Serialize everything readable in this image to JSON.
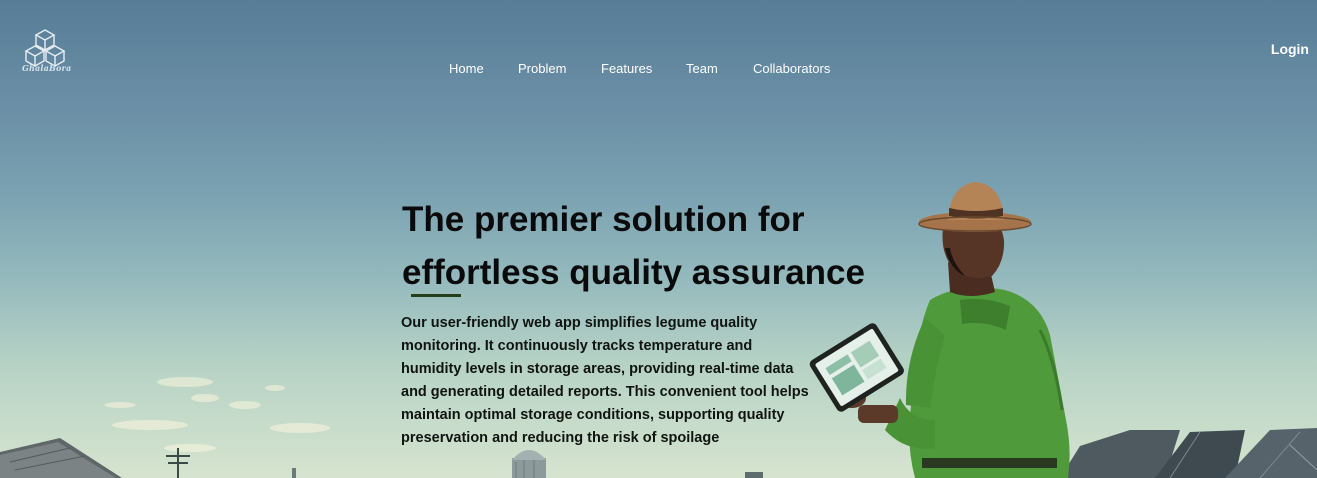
{
  "brand": {
    "logo_icon": "cubes-logo-icon",
    "logo_text": "GhalaBora"
  },
  "nav": {
    "items": [
      {
        "label": "Home"
      },
      {
        "label": "Problem"
      },
      {
        "label": "Features"
      },
      {
        "label": "Team"
      },
      {
        "label": "Collaborators"
      }
    ],
    "login_label": "Login"
  },
  "hero": {
    "headline_line1": "The premier solution for",
    "headline_line2": "effortless quality assurance",
    "description": "Our user-friendly web app simplifies legume quality monitoring. It continuously tracks temperature and humidity levels in storage areas, providing real-time data and generating detailed reports. This convenient tool helps maintain optimal storage conditions, supporting quality preservation and reducing the risk of spoilage",
    "accent_color": "#254019",
    "illustration": "farmer-with-tablet-illustration"
  }
}
